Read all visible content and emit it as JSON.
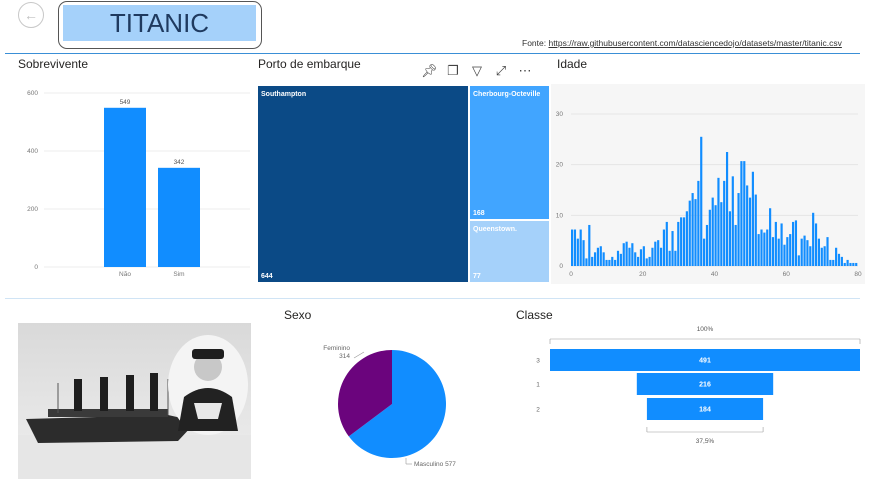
{
  "header": {
    "title": "TITANIC",
    "back_icon": "back-arrow-icon",
    "source_prefix": "Fonte: ",
    "source_link": "https://raw.githubusercontent.com/datasciencedojo/datasets/master/titanic.csv"
  },
  "colors": {
    "accent": "#118dff",
    "dark_blue": "#0b4a86",
    "light_blue": "#41a5ff",
    "pale_blue": "#a5d1fa",
    "purple": "#6b047d",
    "divider": "#3a8fd6"
  },
  "visuals": {
    "survived": {
      "title": "Sobrevivente"
    },
    "embark": {
      "title": "Porto de embarque",
      "toolbar": [
        "pin-icon",
        "copy-icon",
        "filter-icon",
        "focus-mode-icon",
        "more-options-icon"
      ]
    },
    "age": {
      "title": "Idade"
    },
    "sex": {
      "title": "Sexo"
    },
    "class": {
      "title": "Classe"
    }
  },
  "chart_data": [
    {
      "type": "bar",
      "title": "Sobrevivente",
      "categories": [
        "Não",
        "Sim"
      ],
      "values": [
        549,
        342
      ],
      "ylim": [
        0,
        600
      ],
      "yticks": [
        "0",
        "200",
        "400",
        "600"
      ]
    },
    {
      "type": "treemap",
      "title": "Porto de embarque",
      "items": [
        {
          "label": "Southampton",
          "value": 644,
          "value_label": "644"
        },
        {
          "label": "Cherbourg-Octeville",
          "value": 168,
          "value_label": "168"
        },
        {
          "label": "Queenstown.",
          "value": 77,
          "value_label": "77"
        }
      ]
    },
    {
      "type": "bar",
      "title": "Idade",
      "xlim": [
        0,
        80
      ],
      "ylim": [
        0,
        30
      ],
      "xticks": [
        "0",
        "20",
        "40",
        "60",
        "80"
      ],
      "yticks": [
        "0",
        "10",
        "20",
        "30"
      ],
      "x": [
        0.42,
        0.67,
        0.75,
        0.83,
        0.92,
        1,
        2,
        3,
        4,
        5,
        6,
        7,
        8,
        9,
        10,
        11,
        12,
        13,
        14,
        14.5,
        15,
        16,
        17,
        18,
        19,
        20,
        20.5,
        21,
        22,
        23,
        23.5,
        24,
        24.5,
        25,
        26,
        27,
        28,
        28.5,
        29,
        30,
        30.5,
        31,
        32,
        32.5,
        33,
        34,
        34.5,
        35,
        36,
        36.5,
        37,
        38,
        39,
        40,
        40.5,
        41,
        42,
        43,
        44,
        45,
        45.5,
        46,
        47,
        48,
        49,
        50,
        51,
        52,
        53,
        54,
        55,
        55.5,
        56,
        57,
        58,
        59,
        60,
        61,
        62,
        63,
        64,
        65,
        66,
        70,
        70.5,
        71,
        74,
        80
      ],
      "values": [
        1,
        1,
        1,
        2,
        2,
        7,
        10,
        6,
        10,
        4,
        3,
        3,
        2,
        8,
        2,
        4,
        1,
        2,
        6,
        1,
        5,
        17,
        13,
        26,
        25,
        15,
        1,
        24,
        27,
        15,
        1,
        30,
        2,
        23,
        18,
        18,
        25,
        2,
        20,
        25,
        2,
        17,
        18,
        2,
        15,
        15,
        1,
        18,
        22,
        1,
        6,
        11,
        14,
        13,
        2,
        6,
        13,
        5,
        9,
        12,
        2,
        6,
        9,
        9,
        6,
        10,
        7,
        6,
        1,
        8,
        2,
        1,
        4,
        2,
        5,
        2,
        4,
        2,
        3,
        2,
        4,
        3,
        1,
        3,
        1,
        2,
        1,
        1
      ],
      "bar_fractions_percent": [
        24,
        24,
        18,
        24,
        17,
        5,
        27,
        6,
        9,
        12,
        13,
        9,
        4,
        4,
        6,
        4,
        10,
        8,
        15,
        16,
        12,
        15,
        9,
        6,
        11,
        13,
        5,
        6,
        12,
        16,
        17,
        12,
        24,
        29,
        10,
        23,
        10,
        29,
        32,
        32,
        36,
        43,
        48,
        44,
        56,
        85,
        18,
        27,
        37,
        45,
        40,
        58,
        42,
        56,
        75,
        36,
        59,
        27,
        48,
        69,
        69,
        53,
        45,
        62,
        47,
        21,
        24,
        22,
        24,
        38,
        19,
        29,
        18,
        28,
        14,
        19,
        21,
        29,
        30,
        7,
        18,
        20,
        17,
        13,
        35,
        28,
        18,
        12,
        13,
        19,
        4,
        4,
        12,
        8,
        6,
        2,
        4,
        2,
        2,
        2
      ]
    },
    {
      "type": "pie",
      "title": "Sexo",
      "slices": [
        {
          "label": "Feminino",
          "value": 314,
          "value_label": "314"
        },
        {
          "label": "Masculino",
          "value": 577,
          "value_label": "577"
        }
      ]
    },
    {
      "type": "funnel",
      "title": "Classe",
      "top_percent": "100%",
      "bottom_percent": "37,5%",
      "stages": [
        {
          "label": "3",
          "value": 491,
          "value_label": "491"
        },
        {
          "label": "1",
          "value": 216,
          "value_label": "216"
        },
        {
          "label": "2",
          "value": 184,
          "value_label": "184"
        }
      ]
    }
  ]
}
